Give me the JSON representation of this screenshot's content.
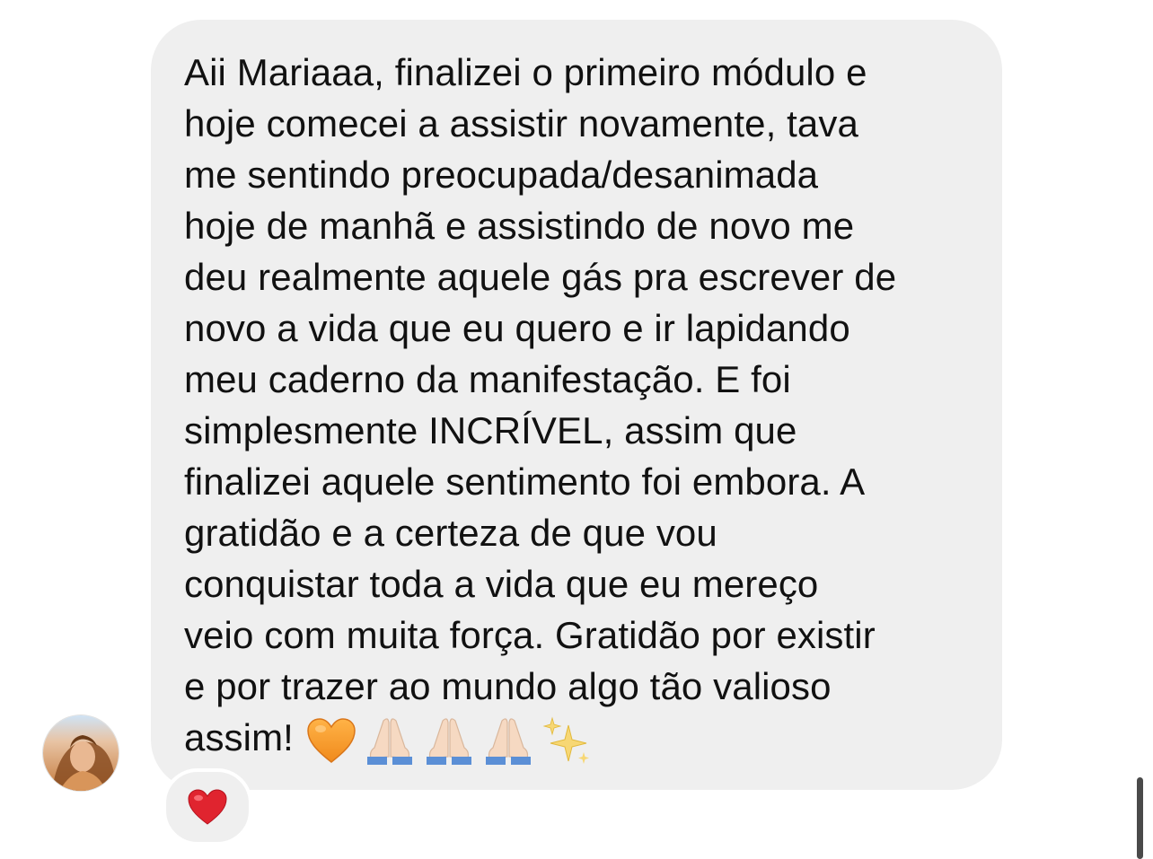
{
  "message": {
    "lines": [
      "Aii Mariaaa, finalizei o primeiro módulo e",
      "hoje comecei a assistir novamente, tava",
      "me sentindo preocupada/desanimada",
      "hoje de manhã e assistindo de novo me",
      "deu realmente aquele gás pra escrever de",
      "novo a vida que eu quero e ir lapidando",
      "meu caderno da manifestação. E foi",
      "simplesmente INCRÍVEL, assim que",
      "finalizei aquele sentimento foi embora. A",
      "gratidão e a certeza de que vou",
      "conquistar toda a vida que eu mereço",
      "veio com muita força. Gratidão por existir",
      "e por trazer ao mundo algo tão valioso",
      "assim!"
    ],
    "emojis": [
      "orange-heart",
      "folded-hands",
      "folded-hands",
      "folded-hands",
      "sparkles"
    ],
    "bubble_color": "#efefef",
    "text_color": "#111111"
  },
  "reaction": {
    "emoji": "red-heart",
    "color": "#e0242f"
  },
  "avatar": {
    "icon": "user-avatar"
  }
}
